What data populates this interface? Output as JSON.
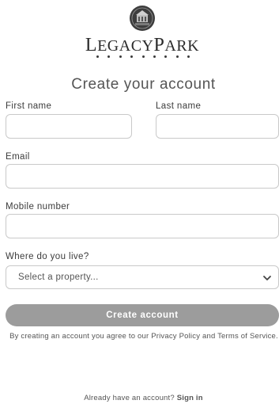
{
  "brand": {
    "wordmark_first": "L",
    "wordmark_rest": "EGACY",
    "wordmark_second": "P",
    "wordmark_second_rest": "ARK",
    "emblem_icon": "legacy-park-emblem-icon"
  },
  "form": {
    "title": "Create your account",
    "first_name_label": "First name",
    "first_name_value": "",
    "last_name_label": "Last name",
    "last_name_value": "",
    "email_label": "Email",
    "email_value": "",
    "mobile_label": "Mobile number",
    "mobile_value": "",
    "residence_label": "Where do you live?",
    "residence_selected": "Select a property...",
    "residence_icon": "chevron-down-icon",
    "submit_label": "Create account",
    "terms_text": "By creating an account you agree to our Privacy Policy and Terms of Service."
  },
  "footer": {
    "prompt": "Already have an account?",
    "signin_label": "Sign in"
  },
  "colors": {
    "button_bg": "#9c9c9c",
    "border": "#c9c9c9",
    "text": "#333333"
  }
}
